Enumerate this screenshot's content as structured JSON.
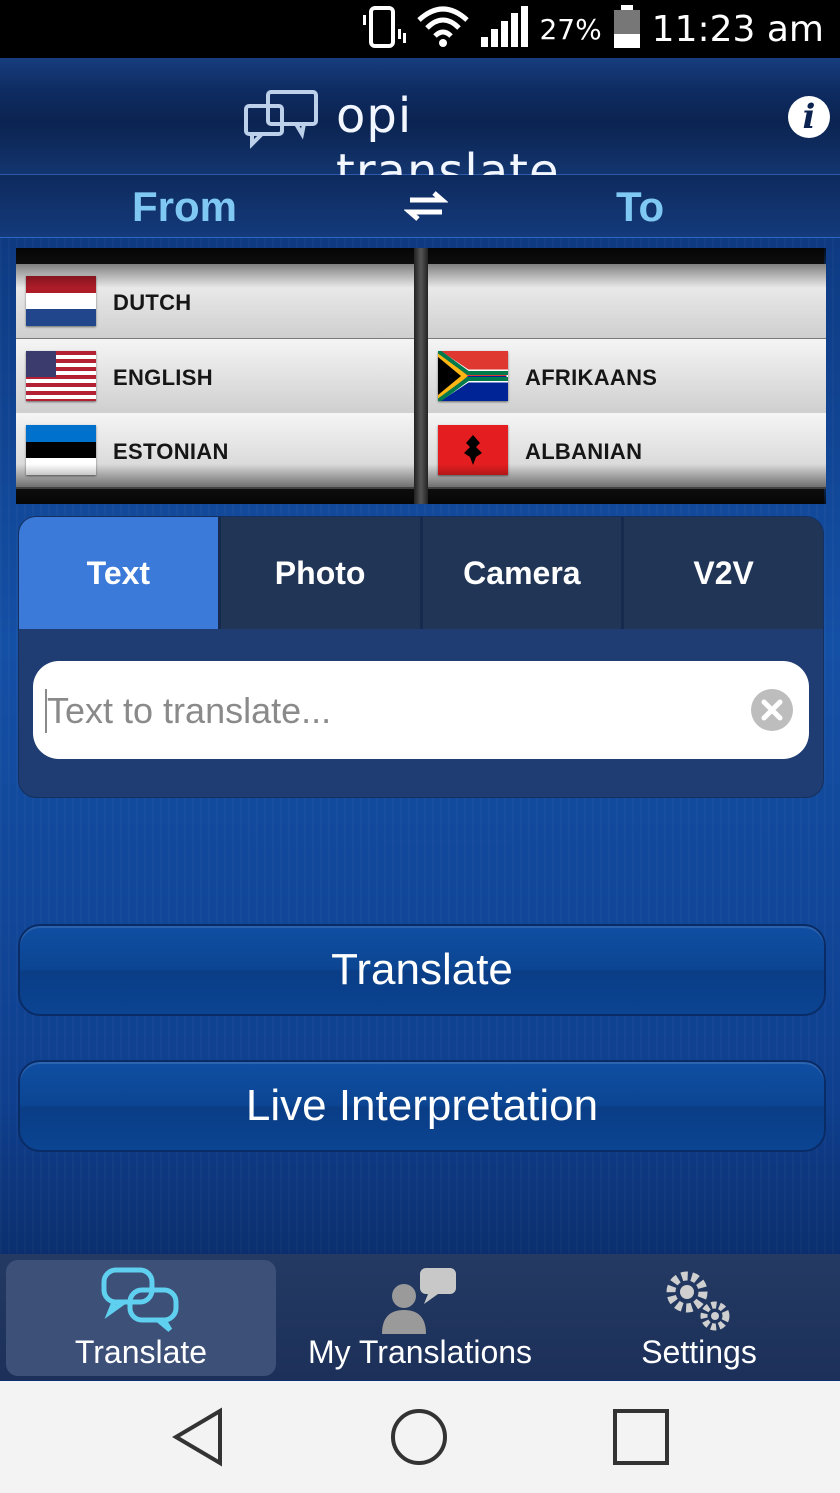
{
  "status_bar": {
    "battery_percent": "27%",
    "time": "11:23 am",
    "icons": [
      "vibrate-icon",
      "wifi-icon",
      "signal-icon",
      "battery-icon"
    ]
  },
  "app": {
    "title": "opi translate"
  },
  "language_header": {
    "from_label": "From",
    "to_label": "To"
  },
  "picker": {
    "from_languages": [
      {
        "name": "DUTCH",
        "flag": "netherlands-flag-icon"
      },
      {
        "name": "ENGLISH",
        "flag": "usa-flag-icon"
      },
      {
        "name": "ESTONIAN",
        "flag": "estonia-flag-icon"
      }
    ],
    "to_languages": [
      {
        "name": "",
        "flag": ""
      },
      {
        "name": "AFRIKAANS",
        "flag": "south-africa-flag-icon"
      },
      {
        "name": "ALBANIAN",
        "flag": "albania-flag-icon"
      }
    ]
  },
  "tabs": [
    {
      "label": "Text",
      "active": true
    },
    {
      "label": "Photo",
      "active": false
    },
    {
      "label": "Camera",
      "active": false
    },
    {
      "label": "V2V",
      "active": false
    }
  ],
  "text_input": {
    "placeholder": "Text to translate...",
    "value": ""
  },
  "buttons": {
    "translate": "Translate",
    "live_interpretation": "Live Interpretation"
  },
  "bottom_nav": [
    {
      "label": "Translate",
      "icon": "speech-bubbles-icon",
      "active": true
    },
    {
      "label": "My Translations",
      "icon": "user-chat-icon",
      "active": false
    },
    {
      "label": "Settings",
      "icon": "gears-icon",
      "active": false
    }
  ],
  "colors": {
    "accent_tab": "#3b7ad9",
    "from_to_text": "#7fc8f3",
    "header_bg": "#0b2350"
  }
}
